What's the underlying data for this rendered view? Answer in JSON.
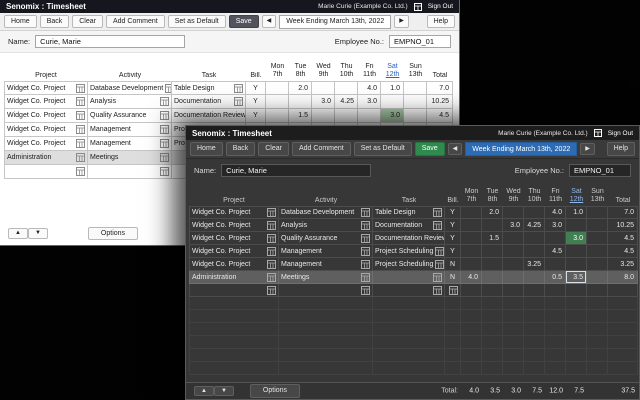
{
  "colors": {
    "save_green": "#2e8a4d",
    "week_blue": "#2d6cb4",
    "link_blue": "#2b62c4",
    "hl_green_light": "#a9cba9",
    "hl_green_dark": "#3f7f52"
  },
  "app": {
    "title": "Senomix : Timesheet",
    "user": "Marie Curie  (Example Co. Ltd.)",
    "sign_out_label": "Sign Out"
  },
  "toolbar": {
    "home": "Home",
    "back": "Back",
    "clear": "Clear",
    "add_comment": "Add Comment",
    "set_as_default": "Set as Default",
    "save": "Save",
    "prev_arrow": "◀",
    "next_arrow": "▶",
    "week_ending": "Week Ending March 13th, 2022",
    "help": "Help"
  },
  "form": {
    "name_label": "Name:",
    "name_value": "Curie, Marie",
    "employee_label": "Employee No.:",
    "employee_value": "EMPNO_01"
  },
  "table": {
    "columns": {
      "project": "Project",
      "activity": "Activity",
      "task": "Task",
      "bill": "Bill.",
      "total": "Total"
    },
    "day_headers": [
      {
        "day": "Mon",
        "date": "7th",
        "link": false
      },
      {
        "day": "Tue",
        "date": "8th",
        "link": false
      },
      {
        "day": "Wed",
        "date": "9th",
        "link": false
      },
      {
        "day": "Thu",
        "date": "10th",
        "link": false
      },
      {
        "day": "Fri",
        "date": "11th",
        "link": false
      },
      {
        "day": "Sat",
        "date": "12th",
        "link": true
      },
      {
        "day": "Sun",
        "date": "13th",
        "link": false
      }
    ],
    "rows": [
      {
        "project": "Widget Co. Project",
        "activity": "Database Development",
        "task": "Table Design",
        "bill": "Y",
        "days": [
          "",
          "2.0",
          "",
          "",
          "4.0",
          "1.0",
          ""
        ],
        "total": "7.0"
      },
      {
        "project": "Widget Co. Project",
        "activity": "Analysis",
        "task": "Documentation",
        "bill": "Y",
        "days": [
          "",
          "",
          "3.0",
          "4.25",
          "3.0",
          "",
          ""
        ],
        "total": "10.25"
      },
      {
        "project": "Widget Co. Project",
        "activity": "Quality Assurance",
        "task": "Documentation Review",
        "bill": "Y",
        "days": [
          "",
          "1.5",
          "",
          "",
          "",
          "3.0",
          ""
        ],
        "total": "4.5",
        "highlight_day": 5
      },
      {
        "project": "Widget Co. Project",
        "activity": "Management",
        "task": "Project Scheduling",
        "bill": "Y",
        "days": [
          "",
          "",
          "",
          "",
          "4.5",
          "",
          ""
        ],
        "total": "4.5"
      },
      {
        "project": "Widget Co. Project",
        "activity": "Management",
        "task": "Project Scheduling",
        "bill": "N",
        "days": [
          "",
          "",
          "",
          "3.25",
          "",
          "",
          ""
        ],
        "total": "3.25"
      },
      {
        "project": "Administration",
        "activity": "Meetings",
        "task": "",
        "bill": "N",
        "days": [
          "4.0",
          "",
          "",
          "",
          "0.5",
          "3.5",
          ""
        ],
        "total": "8.0",
        "selected": true,
        "focus_day": 5
      }
    ],
    "footer": {
      "total_label": "Total:",
      "day_totals": [
        "4.0",
        "3.5",
        "3.0",
        "7.5",
        "12.0",
        "7.5",
        ""
      ],
      "grand_total": "37.5"
    }
  },
  "footer_controls": {
    "up": "▲",
    "down": "▼",
    "options": "Options"
  }
}
